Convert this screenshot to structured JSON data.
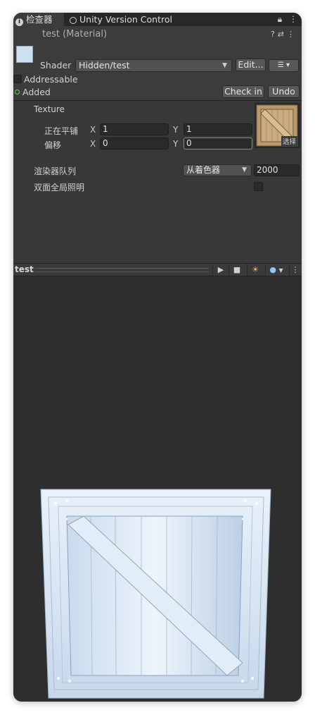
{
  "tabs": {
    "inspector_label": "检查器",
    "version_control_label": "Unity Version Control"
  },
  "material": {
    "title": "test (Material)",
    "shader_label": "Shader",
    "shader_value": "Hidden/test",
    "edit_label": "Edit...",
    "addressable_label": "Addressable",
    "added_label": "Added",
    "check_in_label": "Check in",
    "undo_label": "Undo"
  },
  "properties": {
    "texture_label": "Texture",
    "tiling_label": "正在平铺",
    "offset_label": "偏移",
    "x_label": "X",
    "y_label": "Y",
    "tiling_x": "1",
    "tiling_y": "1",
    "offset_x": "0",
    "offset_y": "0",
    "select_label": "选择",
    "render_queue_label": "渲染器队列",
    "render_queue_mode": "从着色器",
    "render_queue_value": "2000",
    "double_sided_gi_label": "双面全局照明"
  },
  "preview": {
    "title": "test"
  },
  "icons": [
    "info-icon",
    "version-control-icon",
    "lock-icon",
    "more-icon",
    "help-icon",
    "preset-icon",
    "list-icon",
    "play-icon",
    "stop-icon",
    "light-icon",
    "sphere-icon"
  ],
  "colors": {
    "window_bg": "#383838",
    "tab_bar": "#282828",
    "preview_bg": "#2e2e2e",
    "added_dot": "#59d36a",
    "crate_tint": "#dde9f5"
  }
}
